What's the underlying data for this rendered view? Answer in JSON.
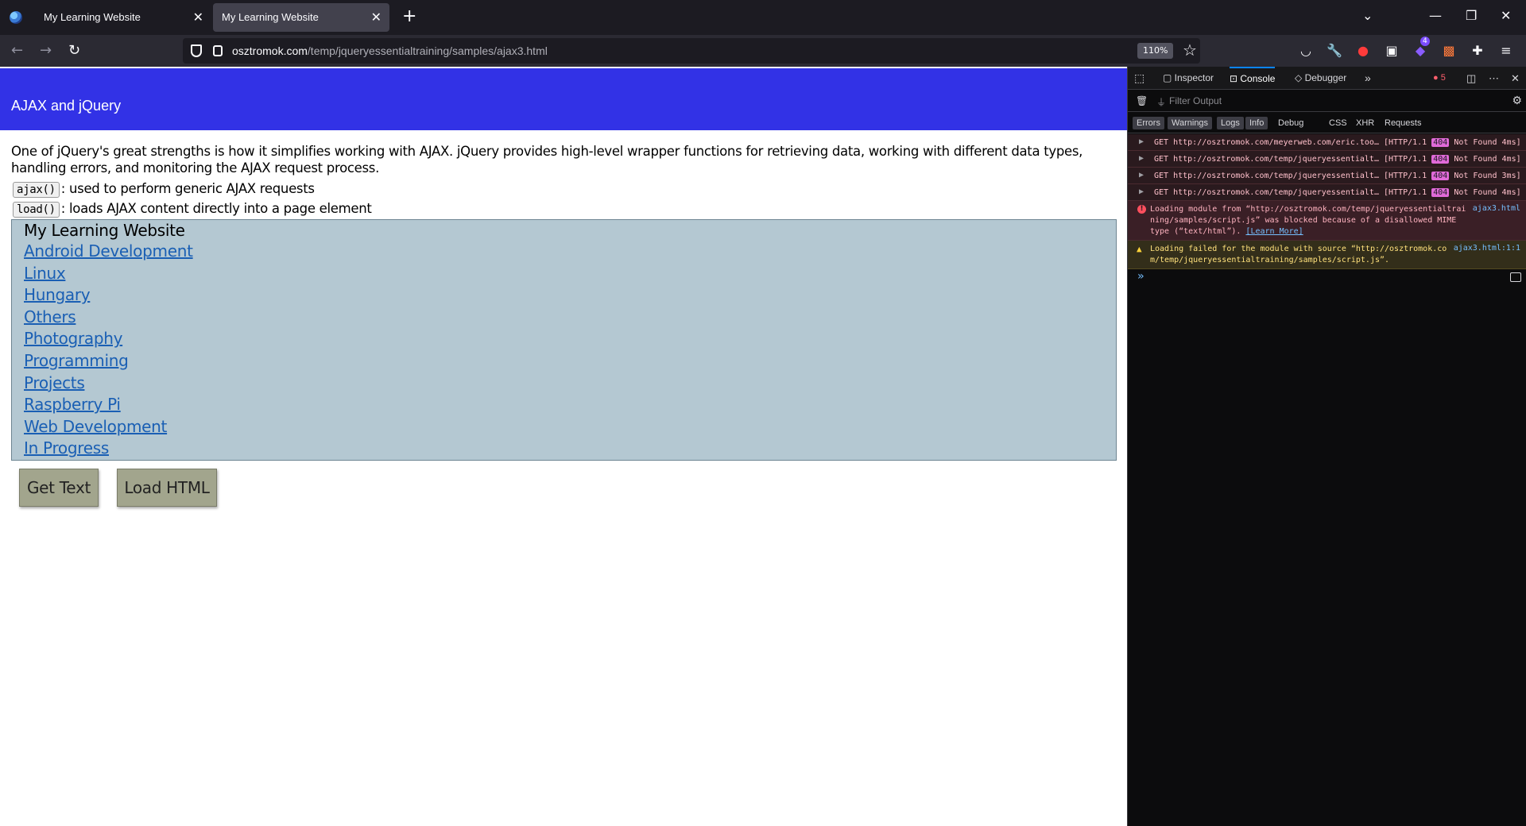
{
  "browser": {
    "tabs": [
      {
        "title": "My Learning Website",
        "active": false
      },
      {
        "title": "My Learning Website",
        "active": true
      }
    ],
    "url_host": "osztromok.com",
    "url_path": "/temp/jqueryessentialtraining/samples/ajax3.html",
    "zoom": "110%",
    "extension_badge": "4"
  },
  "page": {
    "header": "AJAX and jQuery",
    "intro": "One of jQuery's great strengths is how it simplifies working with AJAX. jQuery provides high-level wrapper functions for retrieving data, working with different data types, handling errors, and monitoring the AJAX request process.",
    "defs": [
      {
        "code": "ajax()",
        "desc": ": used to perform generic AJAX requests"
      },
      {
        "code": "load()",
        "desc": ": loads AJAX content directly into a page element"
      }
    ],
    "content_title": "My Learning Website",
    "links": [
      "Android Development",
      "Linux",
      "Hungary",
      "Others",
      "Photography",
      "Programming",
      "Projects",
      "Raspberry Pi",
      "Web Development",
      "In Progress"
    ],
    "buttons": {
      "get_text": "Get Text",
      "load_html": "Load HTML"
    }
  },
  "devtools": {
    "tabs": {
      "inspector": "Inspector",
      "console": "Console",
      "debugger": "Debugger"
    },
    "error_count": "5",
    "filter_placeholder": "Filter Output",
    "levels": {
      "errors": "Errors",
      "warnings": "Warnings",
      "logs": "Logs",
      "info": "Info",
      "debug": "Debug",
      "css": "CSS",
      "xhr": "XHR",
      "requests": "Requests"
    },
    "net_messages": [
      {
        "method": "GET",
        "url": "http://osztromok.com/meyerweb.com/eric.too…",
        "proto": "[HTTP/1.1",
        "status": "404",
        "rest": "Not Found 4ms]"
      },
      {
        "method": "GET",
        "url": "http://osztromok.com/temp/jqueryessentialt…",
        "proto": "[HTTP/1.1",
        "status": "404",
        "rest": "Not Found 4ms]"
      },
      {
        "method": "GET",
        "url": "http://osztromok.com/temp/jqueryessentialt…",
        "proto": "[HTTP/1.1",
        "status": "404",
        "rest": "Not Found 3ms]"
      },
      {
        "method": "GET",
        "url": "http://osztromok.com/temp/jqueryessentialt…",
        "proto": "[HTTP/1.1",
        "status": "404",
        "rest": "Not Found 4ms]"
      }
    ],
    "error_msg": {
      "text1": "Loading module from “http://osztromok.com/temp/jqueryessentialtrai",
      "text2": "ning/samples/script.js” was blocked because of a disallowed MIME",
      "text3": "type (“text/html”).",
      "learn_more": "[Learn More]",
      "source": "ajax3.html"
    },
    "warn_msg": {
      "text1": "Loading failed for the module with source “http://osztromok.co",
      "text2": "m/temp/jqueryessentialtraining/samples/script.js”.",
      "source": "ajax3.html:1:1"
    },
    "prompt": "»"
  }
}
